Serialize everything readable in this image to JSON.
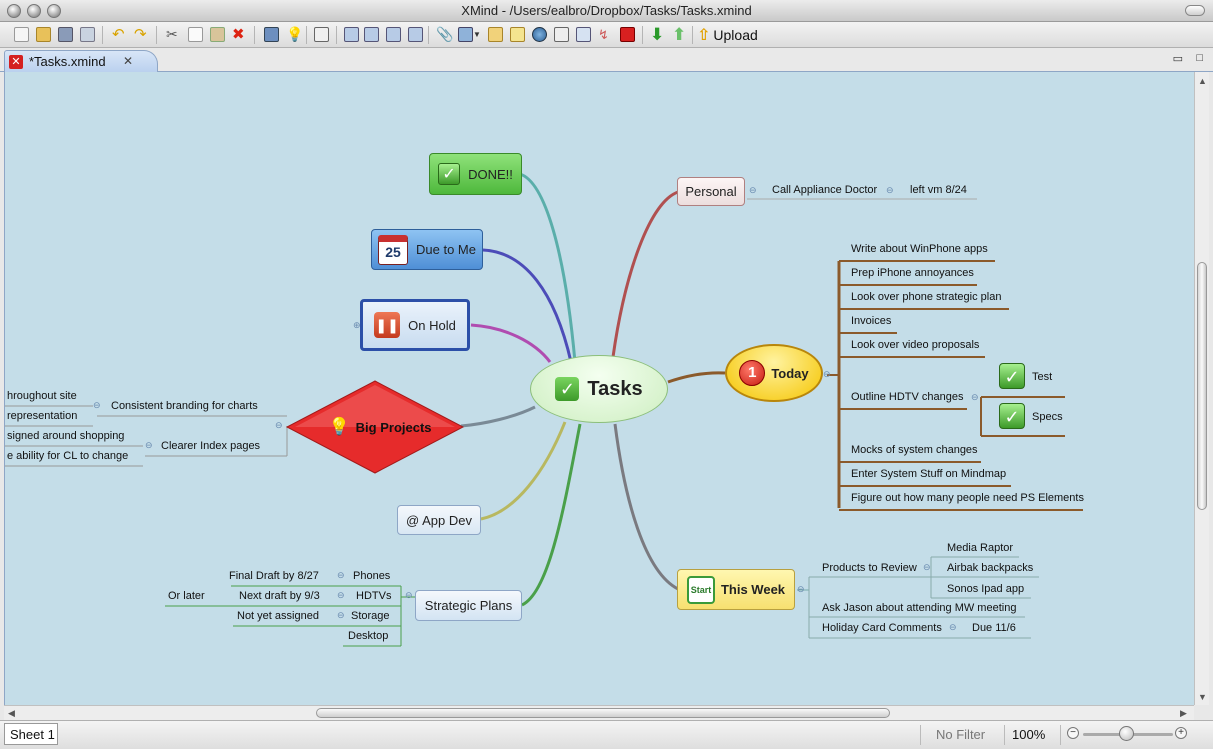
{
  "window": {
    "title": "XMind - /Users/ealbro/Dropbox/Tasks/Tasks.xmind"
  },
  "toolbar": {
    "upload_label": "Upload"
  },
  "editor_tab": {
    "label": "*Tasks.xmind",
    "close": "✕"
  },
  "map": {
    "central": "Tasks",
    "left_topics": {
      "done": "DONE!!",
      "due_to_me": "Due to Me",
      "calendar_day": "25",
      "on_hold": "On Hold",
      "big_projects": "Big Projects",
      "app_dev": "@ App Dev",
      "strategic_plans": "Strategic Plans"
    },
    "big_projects_children": [
      {
        "label": "Consistent branding for charts",
        "children": [
          "hroughout site",
          "representation"
        ]
      },
      {
        "label": "Clearer Index pages",
        "children": [
          "signed around shopping",
          "e ability for CL to change"
        ]
      }
    ],
    "strategic_children": [
      {
        "label": "Phones",
        "children": [
          "Final Draft by 8/27"
        ]
      },
      {
        "label": "HDTVs",
        "children": [
          "Next draft by 9/3"
        ],
        "grand": "Or later"
      },
      {
        "label": "Storage",
        "children": [
          "Not yet assigned"
        ]
      },
      {
        "label": "Desktop",
        "children": []
      }
    ],
    "personal": {
      "label": "Personal",
      "child": "Call Appliance Doctor",
      "grandchild": "left vm 8/24"
    },
    "today": {
      "label": "Today",
      "priority": "1",
      "items": [
        "Write about WinPhone apps",
        "Prep iPhone annoyances",
        "Look over phone strategic plan",
        "Invoices",
        "Look over video proposals",
        "Outline HDTV changes",
        "Mocks of system changes",
        "Enter System Stuff on Mindmap",
        "Figure out how many people need PS Elements"
      ],
      "hdtv_children": [
        "Test",
        "Specs"
      ]
    },
    "this_week": {
      "label": "This Week",
      "start_label": "Start",
      "items": [
        {
          "label": "Products to Review",
          "children": [
            "Media Raptor",
            "Airbak backpacks",
            "Sonos Ipad app"
          ]
        },
        {
          "label": "Ask Jason about attending MW meeting",
          "children": []
        },
        {
          "label": "Holiday Card Comments",
          "children": [
            "Due 11/6"
          ]
        }
      ]
    }
  },
  "statusbar": {
    "sheet": "Sheet 1",
    "filter": "No Filter",
    "zoom": "100%"
  },
  "colors": {
    "canvas": "#c4dde8",
    "today_branch": "#8b5a2b",
    "this_week_branch": "#2e6fa0",
    "strategic_branch": "#4aa04a",
    "done_green": "#5cc24a",
    "due_blue": "#4f8fd6",
    "big_projects_red": "#e62b2b"
  }
}
